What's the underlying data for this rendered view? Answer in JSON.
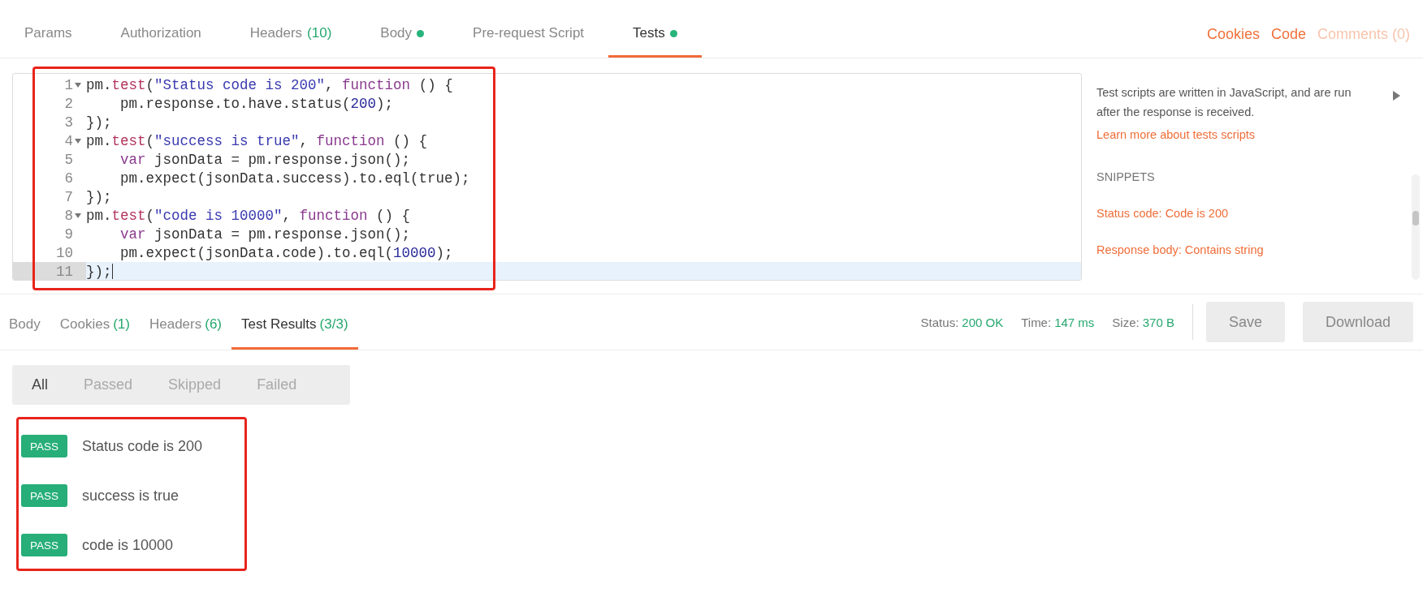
{
  "request_tabs": [
    {
      "label": "Params",
      "selected": false,
      "dot": false
    },
    {
      "label": "Authorization",
      "selected": false,
      "dot": false
    },
    {
      "label": "Headers",
      "count": "(10)",
      "selected": false,
      "dot": false
    },
    {
      "label": "Body",
      "selected": false,
      "dot": true
    },
    {
      "label": "Pre-request Script",
      "selected": false,
      "dot": false
    },
    {
      "label": "Tests",
      "selected": true,
      "dot": true
    }
  ],
  "request_links": [
    {
      "label": "Cookies",
      "disabled": false
    },
    {
      "label": "Code",
      "disabled": false
    },
    {
      "label": "Comments (0)",
      "disabled": true
    }
  ],
  "editor": {
    "highlighted": true,
    "lines": [
      {
        "number": "1",
        "foldable": true,
        "current": false,
        "tokens": [
          {
            "kind": "plain",
            "text": "pm."
          },
          {
            "kind": "method",
            "text": "test"
          },
          {
            "kind": "plain",
            "text": "("
          },
          {
            "kind": "string",
            "text": "\"Status code is 200\""
          },
          {
            "kind": "plain",
            "text": ", "
          },
          {
            "kind": "keyword",
            "text": "function"
          },
          {
            "kind": "plain",
            "text": " () {"
          }
        ]
      },
      {
        "number": "2",
        "foldable": false,
        "current": false,
        "indented": true,
        "tokens": [
          {
            "kind": "plain",
            "text": "pm.response.to.have.status("
          },
          {
            "kind": "number",
            "text": "200"
          },
          {
            "kind": "plain",
            "text": ");"
          }
        ]
      },
      {
        "number": "3",
        "foldable": false,
        "current": false,
        "tokens": [
          {
            "kind": "plain",
            "text": "});"
          }
        ]
      },
      {
        "number": "4",
        "foldable": true,
        "current": false,
        "tokens": [
          {
            "kind": "plain",
            "text": "pm."
          },
          {
            "kind": "method",
            "text": "test"
          },
          {
            "kind": "plain",
            "text": "("
          },
          {
            "kind": "string",
            "text": "\"success is true\""
          },
          {
            "kind": "plain",
            "text": ", "
          },
          {
            "kind": "keyword",
            "text": "function"
          },
          {
            "kind": "plain",
            "text": " () {"
          }
        ]
      },
      {
        "number": "5",
        "foldable": false,
        "current": false,
        "indented": true,
        "tokens": [
          {
            "kind": "keyword",
            "text": "var"
          },
          {
            "kind": "plain",
            "text": " jsonData = pm.response.json();"
          }
        ]
      },
      {
        "number": "6",
        "foldable": false,
        "current": false,
        "indented": true,
        "tokens": [
          {
            "kind": "plain",
            "text": "pm.expect(jsonData.success).to.eql(true);"
          }
        ]
      },
      {
        "number": "7",
        "foldable": false,
        "current": false,
        "tokens": [
          {
            "kind": "plain",
            "text": "});"
          }
        ]
      },
      {
        "number": "8",
        "foldable": true,
        "current": false,
        "tokens": [
          {
            "kind": "plain",
            "text": "pm."
          },
          {
            "kind": "method",
            "text": "test"
          },
          {
            "kind": "plain",
            "text": "("
          },
          {
            "kind": "string",
            "text": "\"code is 10000\""
          },
          {
            "kind": "plain",
            "text": ", "
          },
          {
            "kind": "keyword",
            "text": "function"
          },
          {
            "kind": "plain",
            "text": " () {"
          }
        ]
      },
      {
        "number": "9",
        "foldable": false,
        "current": false,
        "indented": true,
        "tokens": [
          {
            "kind": "keyword",
            "text": "var"
          },
          {
            "kind": "plain",
            "text": " jsonData = pm.response.json();"
          }
        ]
      },
      {
        "number": "10",
        "foldable": false,
        "current": false,
        "indented": true,
        "tokens": [
          {
            "kind": "plain",
            "text": "pm.expect(jsonData.code).to.eql("
          },
          {
            "kind": "number",
            "text": "10000"
          },
          {
            "kind": "plain",
            "text": ");"
          }
        ]
      },
      {
        "number": "11",
        "foldable": false,
        "current": true,
        "tokens": [
          {
            "kind": "plain",
            "text": "});"
          }
        ]
      }
    ]
  },
  "side_panel": {
    "description": "Test scripts are written in JavaScript, and are run after the response is received.",
    "learn_link": "Learn more about tests scripts",
    "snippets_heading": "SNIPPETS",
    "snippets": [
      "Status code: Code is 200",
      "Response body: Contains string"
    ]
  },
  "response_tabs": [
    {
      "label": "Body",
      "selected": false
    },
    {
      "label": "Cookies",
      "count": "(1)",
      "selected": false
    },
    {
      "label": "Headers",
      "count": "(6)",
      "selected": false
    },
    {
      "label": "Test Results",
      "count": "(3/3)",
      "selected": true
    }
  ],
  "response_status": [
    {
      "label": "Status:",
      "value": "200 OK"
    },
    {
      "label": "Time:",
      "value": "147 ms"
    },
    {
      "label": "Size:",
      "value": "370 B"
    }
  ],
  "response_buttons": [
    "Save",
    "Download"
  ],
  "result_filters": [
    {
      "label": "All",
      "selected": true
    },
    {
      "label": "Passed",
      "selected": false
    },
    {
      "label": "Skipped",
      "selected": false
    },
    {
      "label": "Failed",
      "selected": false
    }
  ],
  "test_results": {
    "highlighted": true,
    "items": [
      {
        "status": "PASS",
        "name": "Status code is 200"
      },
      {
        "status": "PASS",
        "name": "success is true"
      },
      {
        "status": "PASS",
        "name": "code is 10000"
      }
    ]
  }
}
